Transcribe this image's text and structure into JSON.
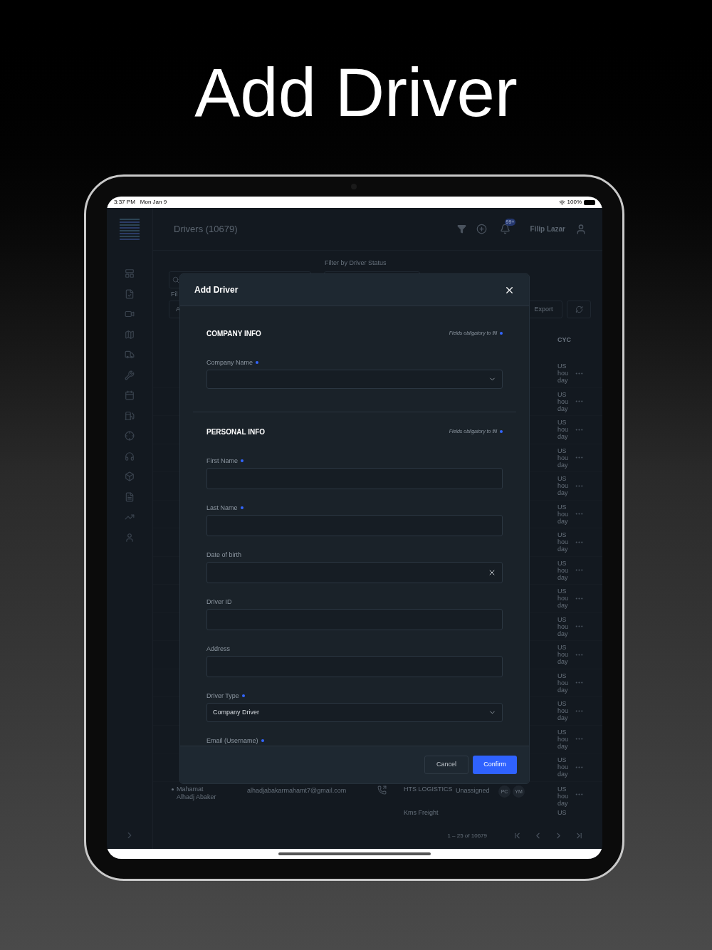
{
  "headline": "Add Driver",
  "status_bar": {
    "time": "3:37 PM",
    "date": "Mon Jan 9",
    "battery": "100%"
  },
  "header": {
    "title": "Drivers (10679)",
    "notification_badge": "99+",
    "user": "Filip Lazar"
  },
  "filters": {
    "status_label": "Filter by Driver Status",
    "filter_label": "Fil",
    "select_value": "A",
    "export": "Export"
  },
  "table": {
    "cycle_heading": "CYC",
    "cycle_rows": [
      {
        "cycle": [
          "US",
          "hou",
          "day"
        ]
      },
      {
        "cycle": [
          "US",
          "hou",
          "day"
        ]
      },
      {
        "cycle": [
          "US",
          "hou",
          "day"
        ]
      },
      {
        "cycle": [
          "US",
          "hou",
          "day"
        ]
      },
      {
        "cycle": [
          "US",
          "hou",
          "day"
        ]
      },
      {
        "cycle": [
          "US",
          "hou",
          "day"
        ]
      },
      {
        "cycle": [
          "US",
          "hou",
          "day"
        ]
      },
      {
        "cycle": [
          "US",
          "hou",
          "day"
        ]
      },
      {
        "cycle": [
          "US",
          "hou",
          "day"
        ]
      },
      {
        "cycle": [
          "US",
          "hou",
          "day"
        ]
      },
      {
        "cycle": [
          "US",
          "hou",
          "day"
        ]
      },
      {
        "cycle": [
          "US",
          "hou",
          "day"
        ]
      },
      {
        "cycle": [
          "US",
          "hou",
          "day"
        ]
      },
      {
        "cycle": [
          "US",
          "hou",
          "day"
        ]
      },
      {
        "cycle": [
          "US",
          "hou",
          "day"
        ]
      }
    ],
    "rows": [
      {
        "name": "Mahamat Alhadj Abaker",
        "email": "alhadjabakarmahamt7@gmail.com",
        "company": "HTS LOGISTICS",
        "status": "Unassigned",
        "badges": [
          "PC",
          "YM"
        ],
        "cycle": [
          "US",
          "hou",
          "day"
        ]
      },
      {
        "company": "Kms Freight",
        "cycle": [
          "US"
        ]
      }
    ]
  },
  "pagination": "1 – 25 of 10679",
  "modal": {
    "title": "Add Driver",
    "sections": [
      {
        "title": "COMPANY INFO",
        "note": "Fields obligatory to fill",
        "fields": [
          {
            "label": "Company Name",
            "required": true,
            "kind": "select"
          }
        ]
      },
      {
        "title": "PERSONAL INFO",
        "note": "Fields obligatory to fill",
        "fields": [
          {
            "label": "First Name",
            "required": true,
            "kind": "text"
          },
          {
            "label": "Last Name",
            "required": true,
            "kind": "text"
          },
          {
            "label": "Date of birth",
            "required": false,
            "kind": "date"
          },
          {
            "label": "Driver ID",
            "required": false,
            "kind": "text"
          },
          {
            "label": "Address",
            "required": false,
            "kind": "text"
          },
          {
            "label": "Driver Type",
            "required": true,
            "kind": "select",
            "value": "Company Driver"
          },
          {
            "label": "Email (Username)",
            "required": true,
            "kind": "label"
          }
        ]
      }
    ],
    "cancel": "Cancel",
    "confirm": "Confirm"
  }
}
